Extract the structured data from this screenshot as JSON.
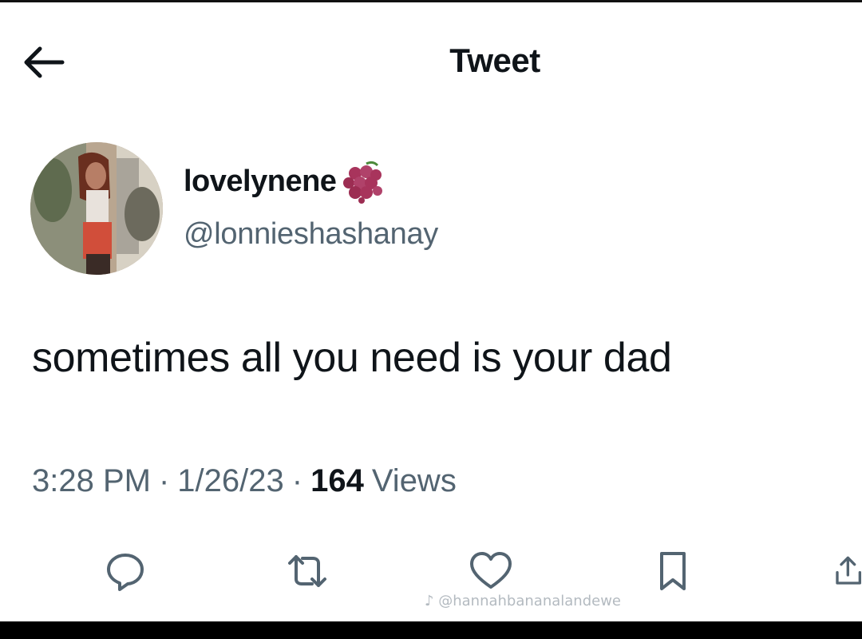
{
  "header": {
    "title": "Tweet",
    "back_icon": "arrow-left-icon"
  },
  "author": {
    "display_name": "lovelynene",
    "emoji": "grapes-icon",
    "handle": "@lonnieshashanay"
  },
  "tweet": {
    "text": "sometimes all you need is your dad"
  },
  "meta": {
    "time": "3:28 PM",
    "separator": "·",
    "date": "1/26/23",
    "views_count": "164",
    "views_label": "Views"
  },
  "actions": [
    {
      "name": "reply",
      "icon": "reply-icon"
    },
    {
      "name": "retweet",
      "icon": "retweet-icon"
    },
    {
      "name": "like",
      "icon": "heart-icon"
    },
    {
      "name": "bookmark",
      "icon": "bookmark-icon"
    },
    {
      "name": "share",
      "icon": "share-icon"
    }
  ],
  "watermark": {
    "text": "@hannahbananalandewe"
  },
  "colors": {
    "text_primary": "#0f1419",
    "text_secondary": "#536471",
    "icon": "#536471",
    "emoji": "#a8345c"
  }
}
